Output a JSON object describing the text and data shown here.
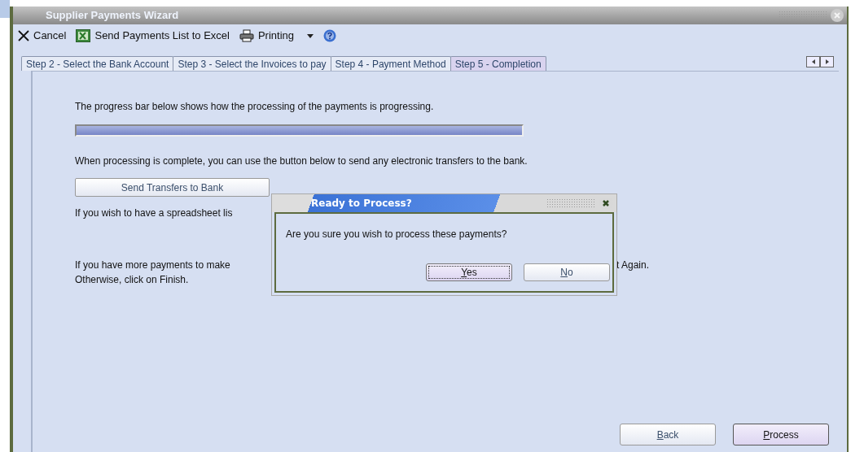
{
  "window": {
    "title": "Supplier Payments Wizard"
  },
  "toolbar": [
    {
      "kind": "cancel",
      "label": "Cancel"
    },
    {
      "kind": "excel",
      "label": "Send Payments List to Excel"
    },
    {
      "kind": "print",
      "label": "Printing"
    },
    {
      "kind": "dropdown"
    },
    {
      "kind": "help"
    }
  ],
  "tabs": [
    {
      "label": "Step 2 - Select the Bank Account",
      "selected": false
    },
    {
      "label": "Step 3 - Select the Invoices to pay",
      "selected": false
    },
    {
      "label": "Step 4 - Payment Method",
      "selected": false
    },
    {
      "label": "Step 5 - Completion",
      "selected": true
    }
  ],
  "content": {
    "progress_text": "The progress bar below shows how the processing of the payments is progressing.",
    "progress": {
      "level": 1
    },
    "transfer_text": "When processing is complete, you can use the button below to send any electronic transfers to the bank.",
    "transfer_button": "Send Transfers to Bank",
    "spreadsheet_text": "If you wish to have a spreadsheet lis",
    "more_text_left": "If you have more payments to make",
    "more_text_right": "t Again.",
    "finish_text": "Otherwise, click on Finish."
  },
  "buttons": [
    {
      "label": "Back",
      "default": false
    },
    {
      "label": "Process",
      "default": true
    }
  ],
  "dialog": {
    "title": "Ready to Process?",
    "message": "Are you sure you wish to process these payments?",
    "buttons": [
      {
        "label": "Yes",
        "focused": true
      },
      {
        "label": "No",
        "focused": false
      }
    ]
  }
}
